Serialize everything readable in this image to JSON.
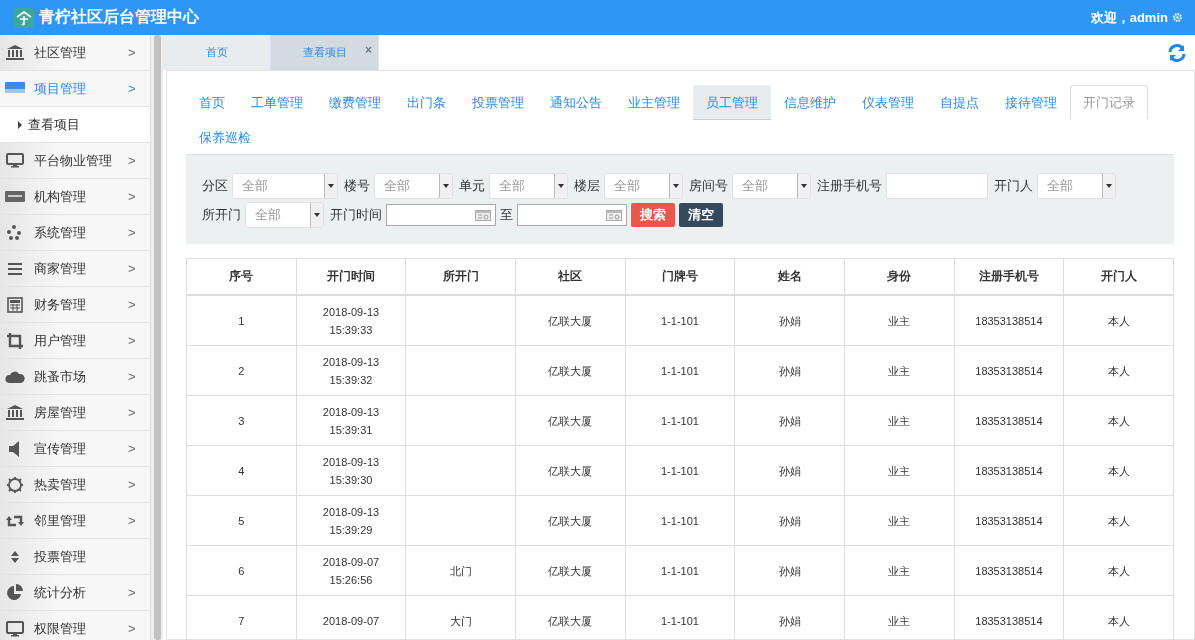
{
  "header": {
    "title": "青柠社区后台管理中心",
    "welcome": "欢迎，admin"
  },
  "sidebar": {
    "items": [
      {
        "label": "社区管理",
        "arrow": ">",
        "selected": false
      },
      {
        "label": "项目管理",
        "arrow": ">",
        "selected": true,
        "children": [
          {
            "label": "查看项目"
          }
        ]
      },
      {
        "label": "平台物业管理",
        "arrow": ">",
        "selected": false
      },
      {
        "label": "机构管理",
        "arrow": ">",
        "selected": false
      },
      {
        "label": "系统管理",
        "arrow": ">",
        "selected": false
      },
      {
        "label": "商家管理",
        "arrow": ">",
        "selected": false
      },
      {
        "label": "财务管理",
        "arrow": ">",
        "selected": false
      },
      {
        "label": "用户管理",
        "arrow": ">",
        "selected": false
      },
      {
        "label": "跳蚤市场",
        "arrow": ">",
        "selected": false
      },
      {
        "label": "房屋管理",
        "arrow": ">",
        "selected": false
      },
      {
        "label": "宣传管理",
        "arrow": ">",
        "selected": false
      },
      {
        "label": "热卖管理",
        "arrow": ">",
        "selected": false
      },
      {
        "label": "邻里管理",
        "arrow": ">",
        "selected": false
      },
      {
        "label": "投票管理",
        "selected": false
      },
      {
        "label": "统计分析",
        "arrow": ">",
        "selected": false
      },
      {
        "label": "权限管理",
        "arrow": ">",
        "selected": false
      }
    ]
  },
  "page_tabs": [
    {
      "label": "首页",
      "selected": false
    },
    {
      "label": "查看项目",
      "selected": true,
      "close": "×"
    }
  ],
  "nav_links": [
    {
      "label": "首页",
      "selected": false,
      "highlighted": false
    },
    {
      "label": "工单管理",
      "selected": false,
      "highlighted": false
    },
    {
      "label": "缴费管理",
      "selected": false,
      "highlighted": false
    },
    {
      "label": "出门条",
      "selected": false,
      "highlighted": false
    },
    {
      "label": "投票管理",
      "selected": false,
      "highlighted": false
    },
    {
      "label": "通知公告",
      "selected": false,
      "highlighted": false
    },
    {
      "label": "业主管理",
      "selected": false,
      "highlighted": false
    },
    {
      "label": "员工管理",
      "selected": false,
      "highlighted": true
    },
    {
      "label": "信息维护",
      "selected": false,
      "highlighted": false
    },
    {
      "label": "仪表管理",
      "selected": false,
      "highlighted": false
    },
    {
      "label": "自提点",
      "selected": false,
      "highlighted": false
    },
    {
      "label": "接待管理",
      "selected": false,
      "highlighted": false
    },
    {
      "label": "开门记录",
      "selected": true,
      "highlighted": false
    },
    {
      "label": "保养巡检",
      "selected": false,
      "highlighted": false
    }
  ],
  "filters": [
    {
      "kind": "select",
      "label": "分区",
      "value": "全部"
    },
    {
      "kind": "select",
      "label": "楼号",
      "value": "全部"
    },
    {
      "kind": "select",
      "label": "单元",
      "value": "全部"
    },
    {
      "kind": "select",
      "label": "楼层",
      "value": "全部"
    },
    {
      "kind": "select",
      "label": "房间号",
      "value": "全部"
    },
    {
      "kind": "input",
      "label": "注册手机号"
    },
    {
      "kind": "select",
      "label": "开门人",
      "value": "全部"
    },
    {
      "kind": "select",
      "label": "所开门",
      "value": "全部"
    },
    {
      "kind": "date",
      "label": "开门时间"
    },
    {
      "kind": "date",
      "label": "至"
    }
  ],
  "buttons": [
    {
      "label": "搜索",
      "kind": "danger"
    },
    {
      "label": "清空",
      "kind": "dark"
    }
  ],
  "table": {
    "columns": [
      "序号",
      "开门时间",
      "所开门",
      "社区",
      "门牌号",
      "姓名",
      "身份",
      "注册手机号",
      "开门人"
    ],
    "rows": [
      [
        "1",
        "2018-09-13 15:39:33",
        "",
        "亿联大厦",
        "1-1-101",
        "孙娟",
        "业主",
        "18353138514",
        "本人"
      ],
      [
        "2",
        "2018-09-13 15:39:32",
        "",
        "亿联大厦",
        "1-1-101",
        "孙娟",
        "业主",
        "18353138514",
        "本人"
      ],
      [
        "3",
        "2018-09-13 15:39:31",
        "",
        "亿联大厦",
        "1-1-101",
        "孙娟",
        "业主",
        "18353138514",
        "本人"
      ],
      [
        "4",
        "2018-09-13 15:39:30",
        "",
        "亿联大厦",
        "1-1-101",
        "孙娟",
        "业主",
        "18353138514",
        "本人"
      ],
      [
        "5",
        "2018-09-13 15:39:29",
        "",
        "亿联大厦",
        "1-1-101",
        "孙娟",
        "业主",
        "18353138514",
        "本人"
      ],
      [
        "6",
        "2018-09-07 15:26:56",
        "北门",
        "亿联大厦",
        "1-1-101",
        "孙娟",
        "业主",
        "18353138514",
        "本人"
      ],
      [
        "7",
        "2018-09-07",
        "大门",
        "亿联大厦",
        "1-1-101",
        "孙娟",
        "业主",
        "18353138514",
        "本人"
      ]
    ]
  }
}
